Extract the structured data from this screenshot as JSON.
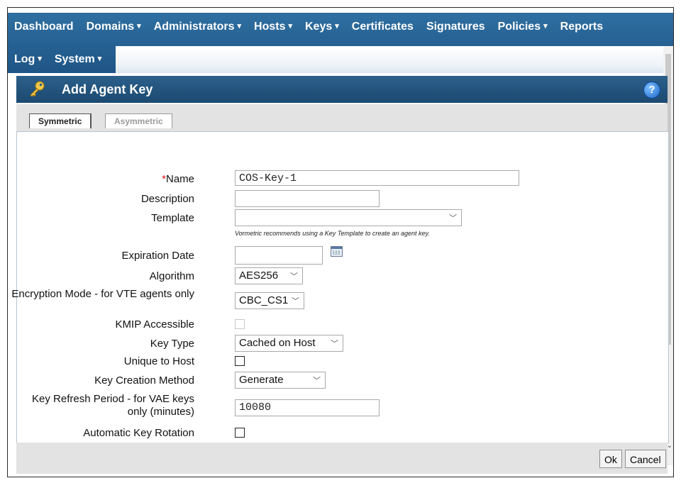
{
  "nav": {
    "row1": [
      "Dashboard",
      "Domains",
      "Administrators",
      "Hosts",
      "Keys",
      "Certificates",
      "Signatures",
      "Policies",
      "Reports"
    ],
    "row1_dropdown": [
      false,
      true,
      true,
      true,
      true,
      false,
      false,
      true,
      false
    ],
    "row2": [
      "Log",
      "System"
    ],
    "row2_dropdown": [
      true,
      true
    ],
    "caret": "▾"
  },
  "header": {
    "title": "Add Agent Key",
    "help": "?"
  },
  "tabs": {
    "symmetric": "Symmetric",
    "asymmetric": "Asymmetric"
  },
  "form": {
    "name_required": "*",
    "name_label": "Name",
    "name_value": "COS-Key-1",
    "description_label": "Description",
    "description_value": "",
    "template_label": "Template",
    "template_value": "",
    "template_hint": "Vormetric recommends using a Key Template to create an agent key.",
    "expiration_label": "Expiration Date",
    "expiration_value": "",
    "algorithm_label": "Algorithm",
    "algorithm_value": "AES256",
    "encryption_label": "Encryption Mode - for VTE agents only",
    "encryption_value": "CBC_CS1",
    "kmip_label": "KMIP Accessible",
    "keytype_label": "Key Type",
    "keytype_value": "Cached on Host",
    "unique_label": "Unique to Host",
    "creation_label": "Key Creation Method",
    "creation_value": "Generate",
    "refresh_label": "Key Refresh Period - for VAE keys only (minutes)",
    "refresh_value": "10080",
    "rotation_label": "Automatic Key Rotation"
  },
  "buttons": {
    "ok": "Ok",
    "cancel": "Cancel"
  },
  "colors": {
    "nav": "#1e5586",
    "header": "#1c4a71",
    "required": "#dd1111"
  },
  "icons": {
    "header": "key-icon",
    "help": "help-icon",
    "calendar": "calendar-icon"
  }
}
